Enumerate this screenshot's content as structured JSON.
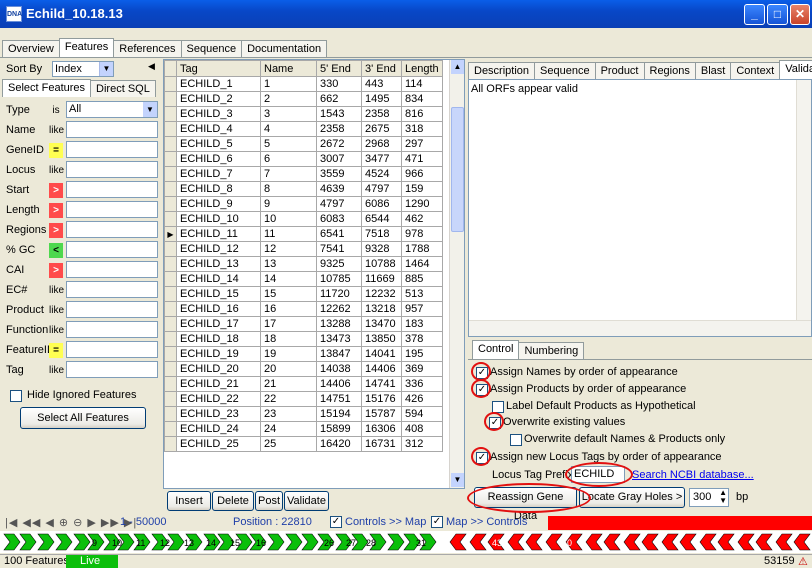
{
  "window": {
    "title": "Echild_10.18.13",
    "app_icon_text": "DNA"
  },
  "main_tabs": [
    "Overview",
    "Features",
    "References",
    "Sequence",
    "Documentation"
  ],
  "main_tab_active": "Features",
  "left": {
    "sort_by_label": "Sort By",
    "sort_by_value": "Index",
    "subtabs": [
      "Select Features",
      "Direct SQL"
    ],
    "filters": [
      {
        "label": "Type",
        "op": "is",
        "op_style": "text",
        "value": "All",
        "combo": true
      },
      {
        "label": "Name",
        "op": "like",
        "op_style": "text",
        "value": ""
      },
      {
        "label": "GeneID",
        "op": "=",
        "op_style": "yellow",
        "value": ""
      },
      {
        "label": "Locus",
        "op": "like",
        "op_style": "text",
        "value": ""
      },
      {
        "label": "Start",
        "op": ">",
        "op_style": "red",
        "value": ""
      },
      {
        "label": "Length",
        "op": ">",
        "op_style": "red",
        "value": ""
      },
      {
        "label": "Regions",
        "op": ">",
        "op_style": "red",
        "value": ""
      },
      {
        "label": "% GC",
        "op": "<",
        "op_style": "green",
        "value": ""
      },
      {
        "label": "CAI",
        "op": ">",
        "op_style": "red",
        "value": ""
      },
      {
        "label": "EC#",
        "op": "like",
        "op_style": "text",
        "value": ""
      },
      {
        "label": "Product",
        "op": "like",
        "op_style": "text",
        "value": ""
      },
      {
        "label": "Function",
        "op": "like",
        "op_style": "text",
        "value": ""
      },
      {
        "label": "FeatureID",
        "op": "=",
        "op_style": "yellow",
        "value": ""
      },
      {
        "label": "Tag",
        "op": "like",
        "op_style": "text",
        "value": ""
      }
    ],
    "hide_ignored_label": "Hide Ignored Features",
    "select_all_label": "Select All Features"
  },
  "grid": {
    "columns": [
      "Tag",
      "Name",
      "5' End",
      "3' End",
      "Length"
    ],
    "rows": [
      [
        "ECHILD_1",
        "1",
        "330",
        "443",
        "114"
      ],
      [
        "ECHILD_2",
        "2",
        "662",
        "1495",
        "834"
      ],
      [
        "ECHILD_3",
        "3",
        "1543",
        "2358",
        "816"
      ],
      [
        "ECHILD_4",
        "4",
        "2358",
        "2675",
        "318"
      ],
      [
        "ECHILD_5",
        "5",
        "2672",
        "2968",
        "297"
      ],
      [
        "ECHILD_6",
        "6",
        "3007",
        "3477",
        "471"
      ],
      [
        "ECHILD_7",
        "7",
        "3559",
        "4524",
        "966"
      ],
      [
        "ECHILD_8",
        "8",
        "4639",
        "4797",
        "159"
      ],
      [
        "ECHILD_9",
        "9",
        "4797",
        "6086",
        "1290"
      ],
      [
        "ECHILD_10",
        "10",
        "6083",
        "6544",
        "462"
      ],
      [
        "ECHILD_11",
        "11",
        "6541",
        "7518",
        "978"
      ],
      [
        "ECHILD_12",
        "12",
        "7541",
        "9328",
        "1788"
      ],
      [
        "ECHILD_13",
        "13",
        "9325",
        "10788",
        "1464"
      ],
      [
        "ECHILD_14",
        "14",
        "10785",
        "11669",
        "885"
      ],
      [
        "ECHILD_15",
        "15",
        "11720",
        "12232",
        "513"
      ],
      [
        "ECHILD_16",
        "16",
        "12262",
        "13218",
        "957"
      ],
      [
        "ECHILD_17",
        "17",
        "13288",
        "13470",
        "183"
      ],
      [
        "ECHILD_18",
        "18",
        "13473",
        "13850",
        "378"
      ],
      [
        "ECHILD_19",
        "19",
        "13847",
        "14041",
        "195"
      ],
      [
        "ECHILD_20",
        "20",
        "14038",
        "14406",
        "369"
      ],
      [
        "ECHILD_21",
        "21",
        "14406",
        "14741",
        "336"
      ],
      [
        "ECHILD_22",
        "22",
        "14751",
        "15176",
        "426"
      ],
      [
        "ECHILD_23",
        "23",
        "15194",
        "15787",
        "594"
      ],
      [
        "ECHILD_24",
        "24",
        "15899",
        "16306",
        "408"
      ],
      [
        "ECHILD_25",
        "25",
        "16420",
        "16731",
        "312"
      ]
    ],
    "current_row": 10,
    "buttons": [
      "Insert",
      "Delete",
      "Post",
      "Validate"
    ]
  },
  "right": {
    "tabs": [
      "Description",
      "Sequence",
      "Product",
      "Regions",
      "Blast",
      "Context",
      "Validation"
    ],
    "active_tab": "Validation",
    "validation_text": "All ORFs appear valid",
    "control_tabs": [
      "Control",
      "Numbering"
    ],
    "options": [
      {
        "label": "Assign Names by order of appearance",
        "checked": true
      },
      {
        "label": "Assign Products by order of appearance",
        "checked": true
      },
      {
        "label": "Label Default Products as Hypothetical",
        "checked": false
      },
      {
        "label": "Overwrite existing values",
        "checked": true
      },
      {
        "label": "Overwrite default Names & Products only",
        "checked": false
      },
      {
        "label": "Assign new Locus Tags by order of appearance",
        "checked": true
      }
    ],
    "locus_prefix_label": "Locus Tag Prefix",
    "locus_prefix_value": "ECHILD",
    "search_link": "Search NCBI database...",
    "reassign_button": "Reassign Gene Data",
    "locate_button": "Locate Gray Holes >",
    "bp_value": "300",
    "bp_label": "bp"
  },
  "map": {
    "range": "1 - 50000",
    "position": "Position : 22810",
    "controls_map": "Controls >> Map",
    "map_controls": "Map >> Controls",
    "forward_labels": [
      "9",
      "10",
      "11",
      "12",
      "13",
      "14",
      "15",
      "16",
      "26",
      "27",
      "28",
      "31"
    ],
    "reverse_labels": [
      "43",
      "50"
    ],
    "colors": {
      "forward": "#0bbf0b",
      "reverse": "#ff0000",
      "link": "#0000ee"
    }
  },
  "status": {
    "features": "100 Features",
    "mode": "Live",
    "number": "53159"
  }
}
